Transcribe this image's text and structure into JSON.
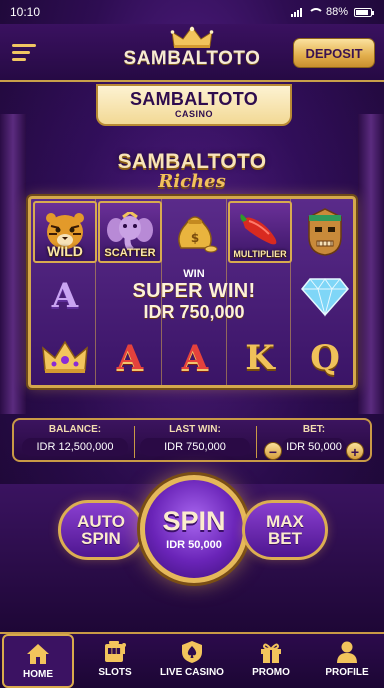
{
  "status_bar": {
    "time": "10:10",
    "battery": "88%",
    "battery_level": 0.88
  },
  "header": {
    "logo_text": "SAMBALTOTO",
    "deposit_label": "DEPOSIT"
  },
  "banner": {
    "title": "SAMBALTOTO",
    "subtitle": "CASINO"
  },
  "game": {
    "title": "SAMBALTOTO",
    "subtitle": "Riches"
  },
  "reels": {
    "row1": [
      {
        "symbol": "tiger-icon",
        "label": "WILD"
      },
      {
        "symbol": "elephant-icon",
        "label": "SCATTER"
      },
      {
        "symbol": "money-bag-icon",
        "label": ""
      },
      {
        "symbol": "chili-icon",
        "label": "MULTIPLIER"
      },
      {
        "symbol": "aztec-mask-icon",
        "label": ""
      }
    ],
    "row2_left": "A",
    "row3": [
      "crown-icon",
      "A",
      "A",
      "K",
      "Q"
    ],
    "row2_right": "diamond-icon",
    "win": {
      "small": "WIN",
      "big": "SUPER WIN!",
      "amount": "IDR 750,000"
    }
  },
  "info": {
    "balance_label": "BALANCE:",
    "balance_value": "IDR 12,500,000",
    "last_win_label": "LAST WIN:",
    "last_win_value": "IDR 750,000",
    "bet_label": "BET:",
    "bet_value": "IDR 50,000",
    "minus": "−",
    "plus": "+"
  },
  "controls": {
    "auto_spin": "AUTO SPIN",
    "spin": "SPIN",
    "spin_amount": "IDR 50,000",
    "max_bet": "MAX BET"
  },
  "nav": [
    {
      "label": "HOME",
      "icon": "home-icon",
      "active": true
    },
    {
      "label": "SLOTS",
      "icon": "slot-machine-icon",
      "active": false
    },
    {
      "label": "LIVE CASINO",
      "icon": "shield-spade-icon",
      "active": false
    },
    {
      "label": "PROMO",
      "icon": "gift-icon",
      "active": false
    },
    {
      "label": "PROFILE",
      "icon": "user-icon",
      "active": false
    }
  ],
  "colors": {
    "gold": "#d4a84c",
    "purple": "#3a1466",
    "red_letter": "#e5423c"
  }
}
